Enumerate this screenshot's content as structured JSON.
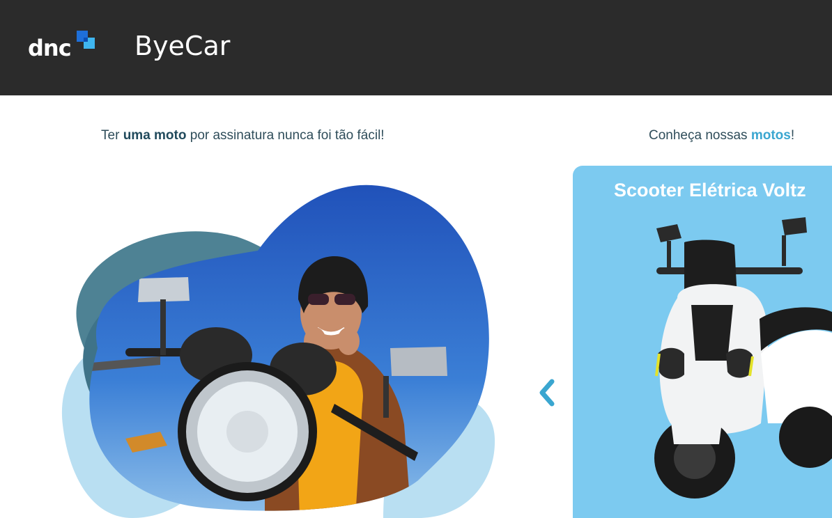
{
  "header": {
    "logo_text": "dnc",
    "app_title": "ByeCar",
    "background": "#2b2b2b"
  },
  "hero": {
    "headline_pre": "Ter ",
    "headline_bold": "uma moto",
    "headline_post": " por assinatura nunca foi tão fácil!",
    "image_alt": "Mulher sorrindo de capacete em uma motocicleta"
  },
  "catalog": {
    "headline_pre": "Conheça nossas ",
    "headline_bold": "motos",
    "headline_post": "!",
    "prev_icon": "chevron-left-icon",
    "card": {
      "title": "Scooter Elétrica Voltz",
      "image_alt": "Scooter elétrica branca",
      "background": "#7ccaf0"
    }
  },
  "colors": {
    "accent": "#3aa6d0",
    "dark_text": "#214a5c"
  }
}
